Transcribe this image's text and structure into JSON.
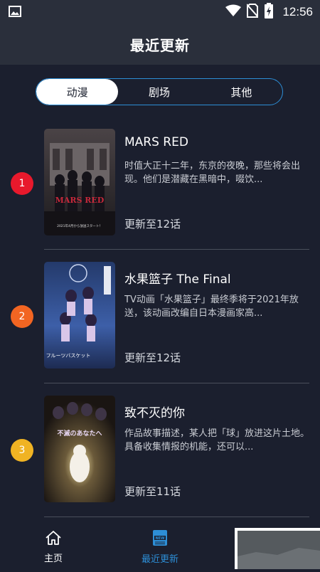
{
  "status_bar": {
    "time": "12:56",
    "icons": [
      "image-icon",
      "wifi-icon",
      "no-sim-icon",
      "battery-charging-icon"
    ]
  },
  "header": {
    "title": "最近更新"
  },
  "tabs": [
    {
      "label": "动漫",
      "active": true
    },
    {
      "label": "剧场",
      "active": false
    },
    {
      "label": "其他",
      "active": false
    }
  ],
  "items": [
    {
      "rank": "1",
      "rank_color": "#e8192c",
      "title": "MARS RED",
      "description": "时值大正十二年，东京的夜晚，那些将会出现。他们是潜藏在黑暗中，啜饮...",
      "episode": "更新至12话",
      "cover_text": [
        "MARS RED",
        "2021年4月から放送スタート！"
      ]
    },
    {
      "rank": "2",
      "rank_color": "#f26522",
      "title": "水果篮子 The Final",
      "description": "TV动画「水果篮子」最终季将于2021年放送，该动画改编自日本漫画家高...",
      "episode": "更新至12话",
      "cover_text": [
        "フルーツバスケット"
      ]
    },
    {
      "rank": "3",
      "rank_color": "#f0b323",
      "title": "致不灭的你",
      "description": "作品故事描述，某人把「球」放进这片土地。具备收集情报的机能，还可以...",
      "episode": "更新至11话",
      "cover_text": [
        "不滅のあなたへ"
      ]
    }
  ],
  "bottom_nav": [
    {
      "label": "主页",
      "icon": "home-icon",
      "active": false
    },
    {
      "label": "最近更新",
      "icon": "news-icon",
      "active": true
    }
  ],
  "colors": {
    "background": "#1b1f2e",
    "bar": "#2a2f3b",
    "accent": "#2d8ed6"
  }
}
